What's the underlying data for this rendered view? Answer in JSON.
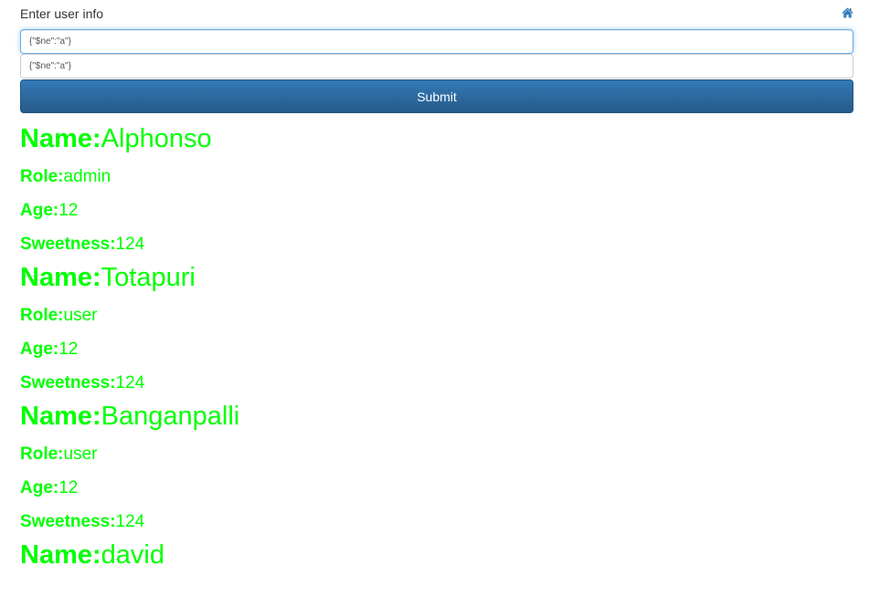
{
  "form": {
    "label": "Enter user info",
    "home_icon": "home-icon",
    "field1_value": "{\"$ne\":\"a\"}",
    "field2_value": "{\"$ne\":\"a\"}",
    "submit_label": "Submit"
  },
  "labels": {
    "name": "Name:",
    "role": "Role:",
    "age": "Age:",
    "sweetness": "Sweetness:"
  },
  "users": [
    {
      "name": "Alphonso",
      "role": "admin",
      "age": "12",
      "sweetness": "124"
    },
    {
      "name": "Totapuri",
      "role": "user",
      "age": "12",
      "sweetness": "124"
    },
    {
      "name": "Banganpalli",
      "role": "user",
      "age": "12",
      "sweetness": "124"
    },
    {
      "name": "david"
    }
  ],
  "colors": {
    "result_text": "#00ff00",
    "button": "#337ab7",
    "focus_border": "#66afe9"
  }
}
